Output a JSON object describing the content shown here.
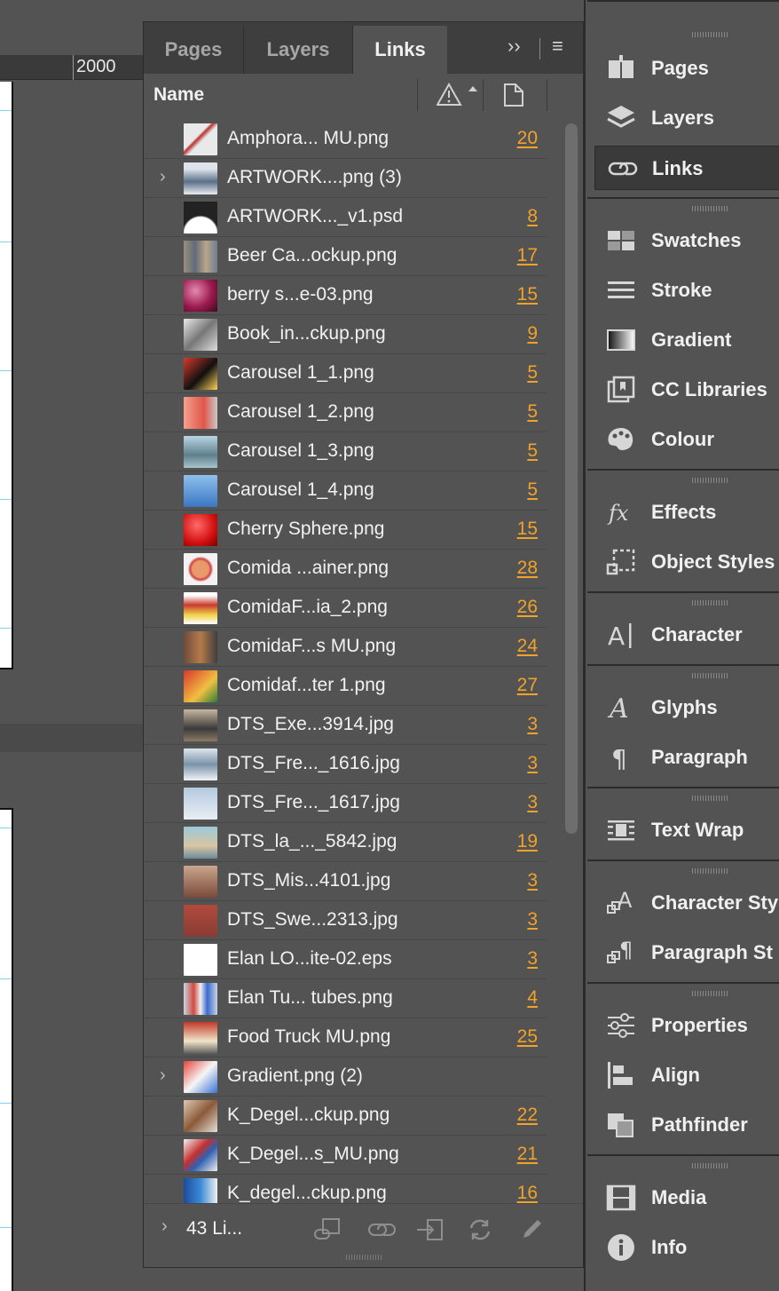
{
  "canvas": {
    "ruler_label": "2000"
  },
  "panel": {
    "tabs": [
      "Pages",
      "Layers",
      "Links"
    ],
    "active_tab": "Links",
    "tab_controls": {
      "collapse": "››",
      "menu": "≡"
    },
    "header": {
      "name": "Name"
    },
    "rows": [
      {
        "name": "Amphora... MU.png",
        "page": "20",
        "expand": ""
      },
      {
        "name": "ARTWORK....png (3)",
        "page": "",
        "expand": "›"
      },
      {
        "name": "ARTWORK..._v1.psd",
        "page": "8",
        "expand": ""
      },
      {
        "name": "Beer Ca...ockup.png",
        "page": "17",
        "expand": ""
      },
      {
        "name": "berry s...e-03.png",
        "page": "15",
        "expand": ""
      },
      {
        "name": "Book_in...ckup.png",
        "page": "9",
        "expand": ""
      },
      {
        "name": "Carousel 1_1.png",
        "page": "5",
        "expand": ""
      },
      {
        "name": "Carousel 1_2.png",
        "page": "5",
        "expand": ""
      },
      {
        "name": "Carousel 1_3.png",
        "page": "5",
        "expand": ""
      },
      {
        "name": "Carousel 1_4.png",
        "page": "5",
        "expand": ""
      },
      {
        "name": "Cherry Sphere.png",
        "page": "15",
        "expand": ""
      },
      {
        "name": "Comida ...ainer.png",
        "page": "28",
        "expand": ""
      },
      {
        "name": "ComidaF...ia_2.png",
        "page": "26",
        "expand": ""
      },
      {
        "name": "ComidaF...s MU.png",
        "page": "24",
        "expand": ""
      },
      {
        "name": "Comidaf...ter 1.png",
        "page": "27",
        "expand": ""
      },
      {
        "name": "DTS_Exe...3914.jpg",
        "page": "3",
        "expand": ""
      },
      {
        "name": "DTS_Fre..._1616.jpg",
        "page": "3",
        "expand": ""
      },
      {
        "name": "DTS_Fre..._1617.jpg",
        "page": "3",
        "expand": ""
      },
      {
        "name": "DTS_la_..._5842.jpg",
        "page": "19",
        "expand": ""
      },
      {
        "name": "DTS_Mis...4101.jpg",
        "page": "3",
        "expand": ""
      },
      {
        "name": "DTS_Swe...2313.jpg",
        "page": "3",
        "expand": ""
      },
      {
        "name": "Elan LO...ite-02.eps",
        "page": "3",
        "expand": ""
      },
      {
        "name": "Elan Tu... tubes.png",
        "page": "4",
        "expand": ""
      },
      {
        "name": "Food Truck MU.png",
        "page": "25",
        "expand": ""
      },
      {
        "name": "Gradient.png (2)",
        "page": "",
        "expand": "›"
      },
      {
        "name": "K_Degel...ckup.png",
        "page": "22",
        "expand": ""
      },
      {
        "name": "K_Degel...s_MU.png",
        "page": "21",
        "expand": ""
      },
      {
        "name": "K_degel...ckup.png",
        "page": "16",
        "expand": ""
      }
    ],
    "footer": {
      "count": "43 Li...",
      "expand": "›"
    }
  },
  "dock": {
    "groups": [
      {
        "items": [
          {
            "label": "Pages",
            "icon": "pages-icon"
          },
          {
            "label": "Layers",
            "icon": "layers-icon"
          },
          {
            "label": "Links",
            "icon": "links-icon",
            "active": true
          }
        ]
      },
      {
        "items": [
          {
            "label": "Swatches",
            "icon": "swatches-icon"
          },
          {
            "label": "Stroke",
            "icon": "stroke-icon"
          },
          {
            "label": "Gradient",
            "icon": "gradient-icon"
          },
          {
            "label": "CC Libraries",
            "icon": "cc-libraries-icon"
          },
          {
            "label": "Colour",
            "icon": "colour-icon"
          }
        ]
      },
      {
        "items": [
          {
            "label": "Effects",
            "icon": "effects-icon"
          },
          {
            "label": "Object Styles",
            "icon": "object-styles-icon"
          }
        ]
      },
      {
        "items": [
          {
            "label": "Character",
            "icon": "character-icon"
          }
        ]
      },
      {
        "items": [
          {
            "label": "Glyphs",
            "icon": "glyphs-icon"
          },
          {
            "label": "Paragraph",
            "icon": "paragraph-icon"
          }
        ]
      },
      {
        "items": [
          {
            "label": "Text Wrap",
            "icon": "text-wrap-icon"
          }
        ]
      },
      {
        "items": [
          {
            "label": "Character Sty",
            "icon": "character-styles-icon"
          },
          {
            "label": "Paragraph St",
            "icon": "paragraph-styles-icon"
          }
        ]
      },
      {
        "items": [
          {
            "label": "Properties",
            "icon": "properties-icon"
          },
          {
            "label": "Align",
            "icon": "align-icon"
          },
          {
            "label": "Pathfinder",
            "icon": "pathfinder-icon"
          }
        ]
      },
      {
        "items": [
          {
            "label": "Media",
            "icon": "media-icon"
          },
          {
            "label": "Info",
            "icon": "info-icon"
          }
        ]
      }
    ]
  },
  "colors": {
    "page_number": "#f0a22a",
    "panel_bg": "#535353",
    "tab_bg": "#3e3e3e",
    "active_dock": "#3a3a3a"
  }
}
